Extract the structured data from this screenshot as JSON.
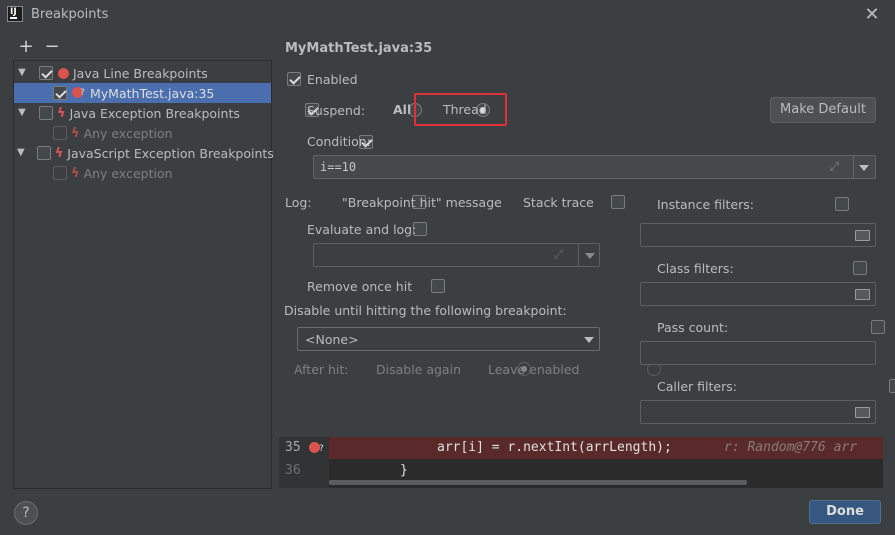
{
  "window": {
    "title": "Breakpoints",
    "close_glyph": "✕"
  },
  "left_toolbar": {
    "add_glyph": "+",
    "remove_glyph": "−"
  },
  "tree": {
    "groups": [
      {
        "label": "Java Line Breakpoints",
        "checked": true
      },
      {
        "label": "MyMathTest.java:35",
        "checked": true,
        "selected": true
      },
      {
        "label": "Java Exception Breakpoints",
        "checked": false
      },
      {
        "label": "Any exception",
        "checked": false,
        "disabled": true
      },
      {
        "label": "JavaScript Exception Breakpoints",
        "checked": false
      },
      {
        "label": "Any exception",
        "checked": false,
        "disabled": true
      }
    ]
  },
  "details": {
    "title": "MyMathTest.java:35",
    "enabled_label": "Enabled",
    "suspend_label": "Suspend:",
    "suspend_all": "All",
    "suspend_thread": "Thread",
    "make_default": "Make Default",
    "condition_label": "Condition:",
    "condition_value": "i==10",
    "log_label": "Log:",
    "log_message": "\"Breakpoint hit\" message",
    "log_stack": "Stack trace",
    "evaluate_label": "Evaluate and log:",
    "remove_once": "Remove once hit",
    "disable_until": "Disable until hitting the following breakpoint:",
    "none_option": "<None>",
    "after_hit": "After hit:",
    "disable_again": "Disable again",
    "leave_enabled": "Leave enabled",
    "instance_filters": "Instance filters:",
    "class_filters": "Class filters:",
    "pass_count": "Pass count:",
    "caller_filters": "Caller filters:"
  },
  "code": {
    "line1_no": "35",
    "line1_code": "arr[i] = r.nextInt(arrLength);",
    "line1_hint": "r: Random@776  arr",
    "line2_no": "36",
    "line2_code": "}"
  },
  "footer": {
    "help": "?",
    "done": "Done"
  },
  "colors": {
    "background": "#3c3f41",
    "selection": "#4b6eaf",
    "breakpoint_red": "#d9534f",
    "highlight_box": "#e0313a",
    "code_line_highlight": "#5a2a2a",
    "primary_button": "#365880"
  }
}
